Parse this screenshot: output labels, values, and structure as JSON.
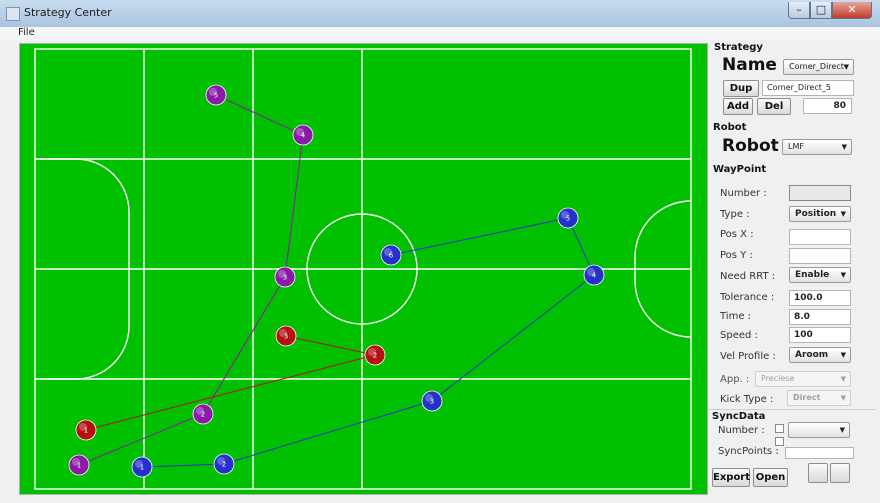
{
  "window": {
    "title": "Strategy Center",
    "min": "–",
    "max": "□",
    "close": "✕"
  },
  "menu": {
    "file": "File"
  },
  "colors": {
    "field": "#00c000",
    "purple": "#8b1aa8",
    "red": "#b31212",
    "blue": "#2631c9"
  },
  "field": {
    "paths": [
      {
        "color": "purple",
        "waypoints": [
          {
            "label": "1"
          },
          {
            "label": "2"
          },
          {
            "label": "3"
          },
          {
            "label": "4"
          },
          {
            "label": "5"
          }
        ]
      },
      {
        "color": "red",
        "waypoints": [
          {
            "label": "1"
          },
          {
            "label": "2"
          },
          {
            "label": "3"
          }
        ]
      },
      {
        "color": "blue",
        "waypoints": [
          {
            "label": "1"
          },
          {
            "label": "2"
          },
          {
            "label": "3"
          },
          {
            "label": "4"
          },
          {
            "label": "5"
          },
          {
            "label": "6"
          }
        ]
      }
    ]
  },
  "strategy": {
    "section": "Strategy",
    "name_label": "Name :",
    "name_value": "Corner_Direct",
    "dup": "Dup",
    "dup_field": "Corner_Direct_5",
    "add": "Add",
    "del": "Del",
    "count": "80"
  },
  "robot": {
    "section": "Robot",
    "label": "Robot :",
    "value": "LMF"
  },
  "waypoint": {
    "section": "WayPoint",
    "number_label": "Number :",
    "number_value": "",
    "type_label": "Type :",
    "type_value": "Position",
    "posx_label": "Pos X :",
    "posx_value": "",
    "posy_label": "Pos Y :",
    "posy_value": "",
    "rrt_label": "Need RRT :",
    "rrt_value": "Enable",
    "tolerance_label": "Tolerance :",
    "tolerance_value": "100.0",
    "time_label": "Time :",
    "time_value": "8.0",
    "speed_label": "Speed :",
    "speed_value": "100",
    "velprofile_label": "Vel Profile :",
    "velprofile_value": "Aroom",
    "app_label": "App. :",
    "app_value": "Preciese",
    "kick_label": "Kick Type :",
    "kick_value": "Direct"
  },
  "syncdata": {
    "section": "SyncData",
    "number_label": "Number :",
    "number_value": "",
    "syncpoints_label": "SyncPoints :",
    "syncpoints_value": ""
  },
  "footer": {
    "export": "Export",
    "open": "Open"
  }
}
